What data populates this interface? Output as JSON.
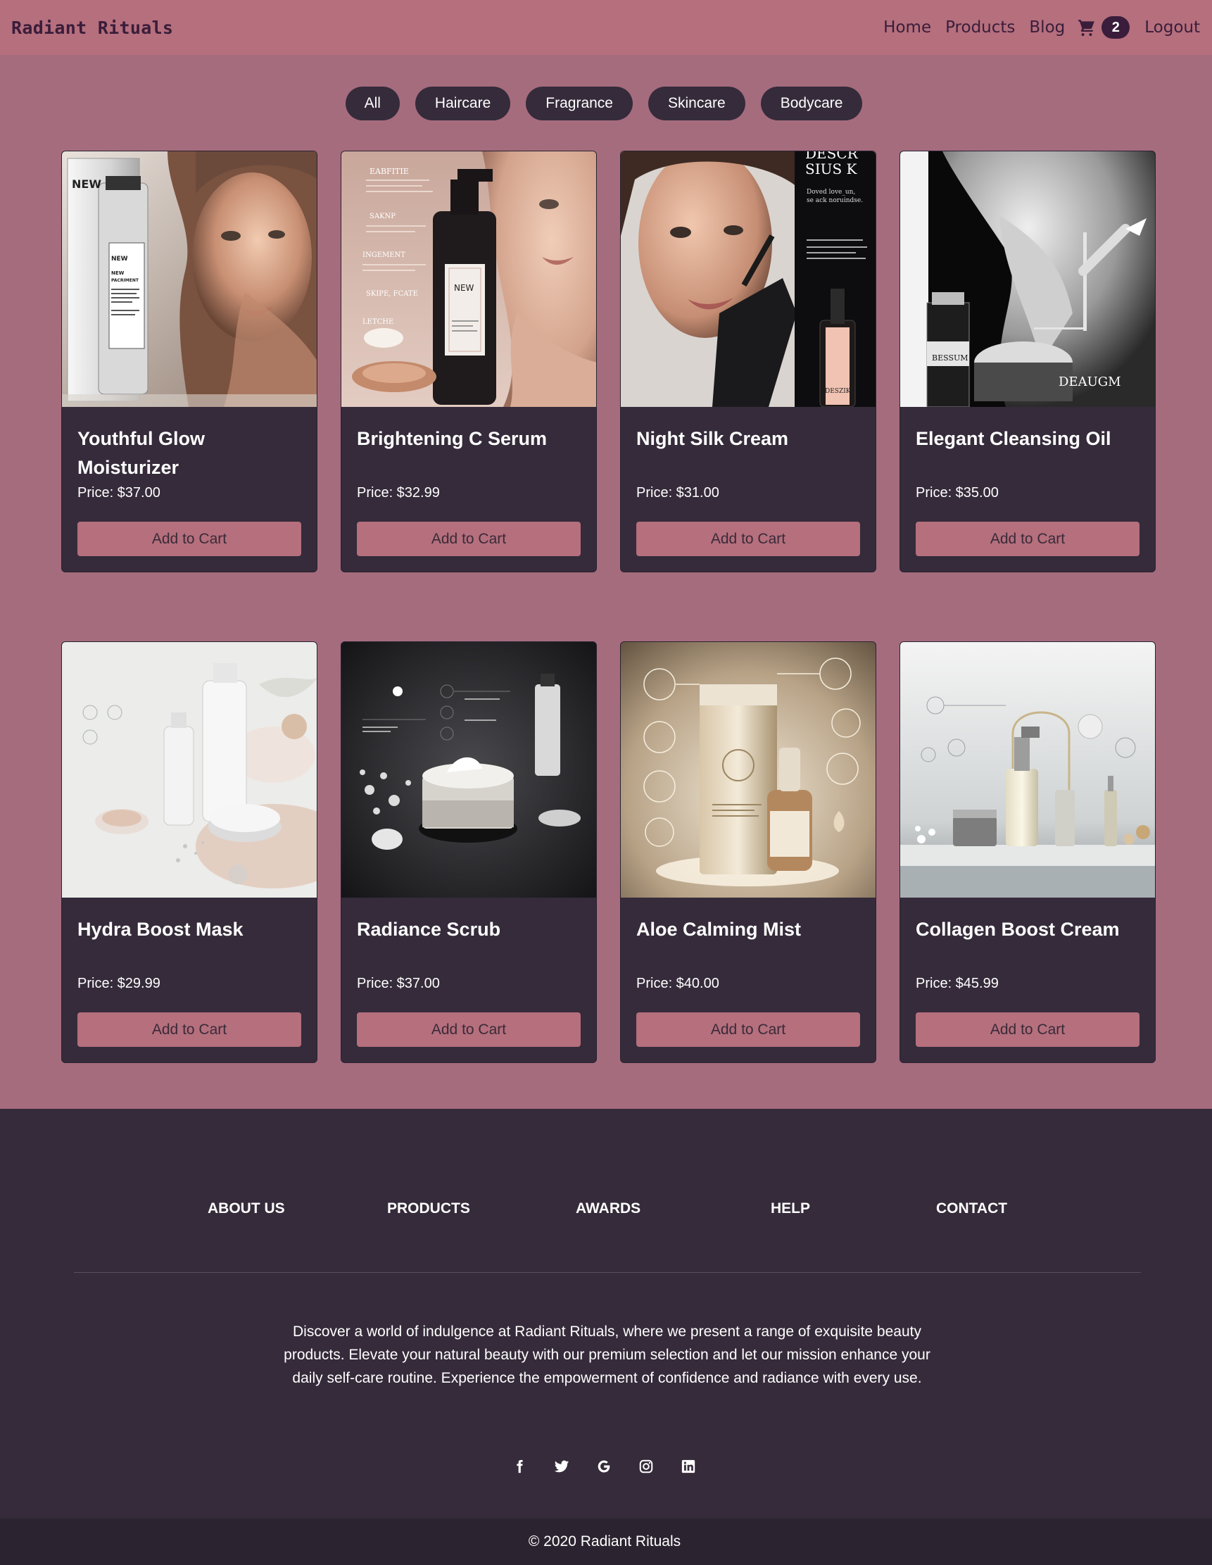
{
  "navbar": {
    "brand": "Radiant Rituals",
    "links": [
      "Home",
      "Products",
      "Blog"
    ],
    "cart_count": "2",
    "logout": "Logout"
  },
  "filters": [
    "All",
    "Haircare",
    "Fragrance",
    "Skincare",
    "Bodycare"
  ],
  "products": [
    {
      "name": "Youthful Glow Moisturizer",
      "price": "Price: $37.00",
      "button": "Add to Cart",
      "image_text": [
        "NEW",
        "NEW",
        "NEW PACRIMENT"
      ]
    },
    {
      "name": "Brightening C Serum",
      "price": "Price: $32.99",
      "button": "Add to Cart",
      "image_text": [
        "EABFITIE",
        "SAKNP",
        "INGEMENT",
        "SKIPE, FCATE",
        "LETCHE",
        "NEW"
      ]
    },
    {
      "name": "Night Silk Cream",
      "price": "Price: $31.00",
      "button": "Add to Cart",
      "image_text": [
        "DESCR",
        "SIUS K",
        "Doved love_un, se ack noruindse.",
        "DESZIK"
      ]
    },
    {
      "name": "Elegant Cleansing Oil",
      "price": "Price: $35.00",
      "button": "Add to Cart",
      "image_text": [
        "DEAUGM",
        "BESSUM"
      ]
    },
    {
      "name": "Hydra Boost Mask",
      "price": "Price: $29.99",
      "button": "Add to Cart",
      "image_text": []
    },
    {
      "name": "Radiance Scrub",
      "price": "Price: $37.00",
      "button": "Add to Cart",
      "image_text": []
    },
    {
      "name": "Aloe Calming Mist",
      "price": "Price: $40.00",
      "button": "Add to Cart",
      "image_text": []
    },
    {
      "name": "Collagen Boost Cream",
      "price": "Price: $45.99",
      "button": "Add to Cart",
      "image_text": []
    }
  ],
  "footer": {
    "links": [
      "ABOUT US",
      "PRODUCTS",
      "AWARDS",
      "HELP",
      "CONTACT"
    ],
    "description": "Discover a world of indulgence at Radiant Rituals, where we present a range of exquisite beauty products. Elevate your natural beauty with our premium selection and let our mission enhance your daily self-care routine. Experience the empowerment of confidence and radiance with every use.",
    "socials": [
      "facebook-icon",
      "twitter-icon",
      "google-icon",
      "instagram-icon",
      "linkedin-icon"
    ],
    "copyright": "© 2020 Radiant Rituals"
  },
  "colors": {
    "page_bg": "#a56c7e",
    "navbar_bg": "#b56f7d",
    "card_bg": "#352b3a",
    "button_bg": "#b56f7d",
    "footer_bg": "#352b3a",
    "copyright_bg": "#2b2430",
    "brand_text": "#3a1d3a"
  }
}
